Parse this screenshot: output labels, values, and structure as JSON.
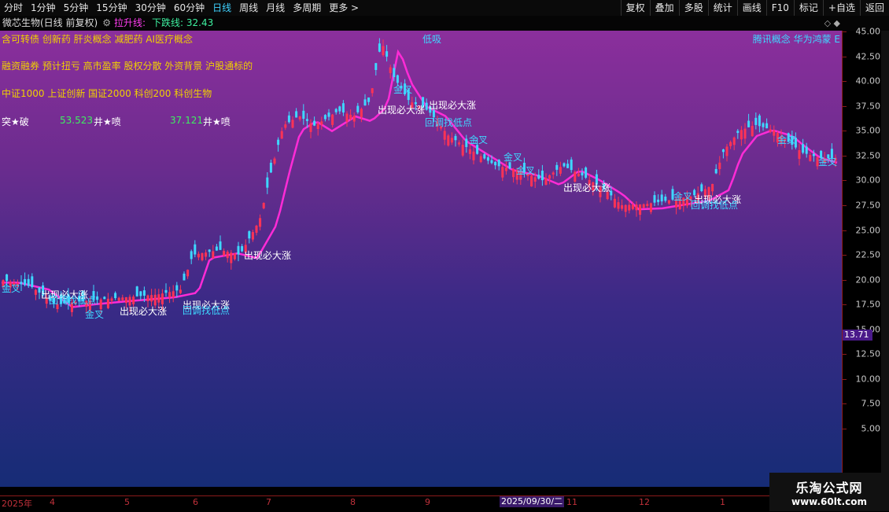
{
  "toolbar": {
    "periods": [
      "分时",
      "1分钟",
      "5分钟",
      "15分钟",
      "30分钟",
      "60分钟",
      "日线",
      "周线",
      "月线",
      "多周期",
      "更多 >"
    ],
    "active_period": "日线",
    "right_buttons": [
      "复权",
      "叠加",
      "多股",
      "统计",
      "画线",
      "F10",
      "标记",
      "+自选",
      "返回"
    ]
  },
  "titlebar": {
    "stock": "微芯生物(日线 前复权)",
    "indicator_up": "拉升线:",
    "indicator_down": "下跌线: 32.43",
    "icons": "◇ ◆"
  },
  "concept_tags": {
    "row1": "含可转债 创新药 肝炎概念 减肥药 AI医疗概念",
    "row1_mid": "低吸",
    "row1_right": "腾讯概念 华为鸿蒙 E",
    "row2": "融资融券 预计扭亏 高市盈率 股权分散 外资背景 沪股通标的",
    "row3": "中证1000 上证创新 国证2000 科创200 科创生物",
    "row4_a": "突★破",
    "row4_b": "53.523",
    "row4_c": "井★喷",
    "row4_d": "37.121",
    "row4_e": "井★喷"
  },
  "y_axis": {
    "ticks": [
      "45.00",
      "42.50",
      "40.00",
      "37.50",
      "35.00",
      "32.50",
      "30.00",
      "27.50",
      "25.00",
      "22.50",
      "20.00",
      "17.50",
      "15.00",
      "12.50",
      "10.00",
      "7.50",
      "5.00"
    ],
    "current_price": "13.71"
  },
  "annotations": {
    "big_rise": "出现必大涨",
    "golden_cross": "金叉",
    "pullback_buy": "回调找低点"
  },
  "timeline": {
    "labels": [
      "2025年",
      "4",
      "5",
      "6",
      "7",
      "8",
      "9",
      "11",
      "12",
      "1"
    ],
    "selected_date": "2025/09/30/二"
  },
  "watermark": {
    "line1": "乐淘公式网",
    "line2": "www.60lt.com"
  },
  "colors": {
    "up": "#ff3355",
    "down": "#3ed8ff",
    "band_up": "#a23045",
    "band_down": "#1f8a6a",
    "ma_line": "#ff2bd6"
  }
}
